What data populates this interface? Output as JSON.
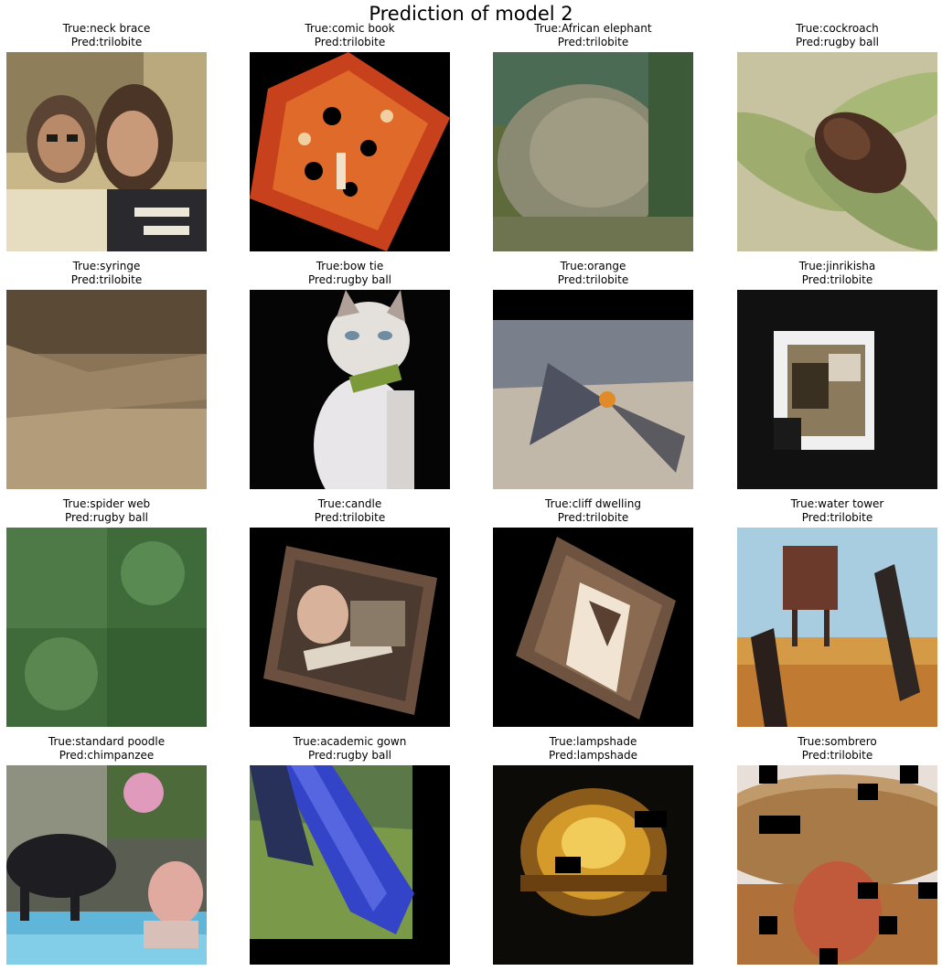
{
  "figure": {
    "title": "Prediction of model 2"
  },
  "panels": [
    {
      "true_label": "True:neck brace",
      "pred_label": "Pred:trilobite"
    },
    {
      "true_label": "True:comic book",
      "pred_label": "Pred:trilobite"
    },
    {
      "true_label": "True:African elephant",
      "pred_label": "Pred:trilobite"
    },
    {
      "true_label": "True:cockroach",
      "pred_label": "Pred:rugby ball"
    },
    {
      "true_label": "True:syringe",
      "pred_label": "Pred:trilobite"
    },
    {
      "true_label": "True:bow tie",
      "pred_label": "Pred:rugby ball"
    },
    {
      "true_label": "True:orange",
      "pred_label": "Pred:trilobite"
    },
    {
      "true_label": "True:jinrikisha",
      "pred_label": "Pred:trilobite"
    },
    {
      "true_label": "True:spider web",
      "pred_label": "Pred:rugby ball"
    },
    {
      "true_label": "True:candle",
      "pred_label": "Pred:trilobite"
    },
    {
      "true_label": "True:cliff dwelling",
      "pred_label": "Pred:trilobite"
    },
    {
      "true_label": "True:water tower",
      "pred_label": "Pred:trilobite"
    },
    {
      "true_label": "True:standard poodle",
      "pred_label": "Pred:chimpanzee"
    },
    {
      "true_label": "True:academic gown",
      "pred_label": "Pred:rugby ball"
    },
    {
      "true_label": "True:lampshade",
      "pred_label": "Pred:lampshade"
    },
    {
      "true_label": "True:sombrero",
      "pred_label": "Pred:trilobite"
    }
  ]
}
